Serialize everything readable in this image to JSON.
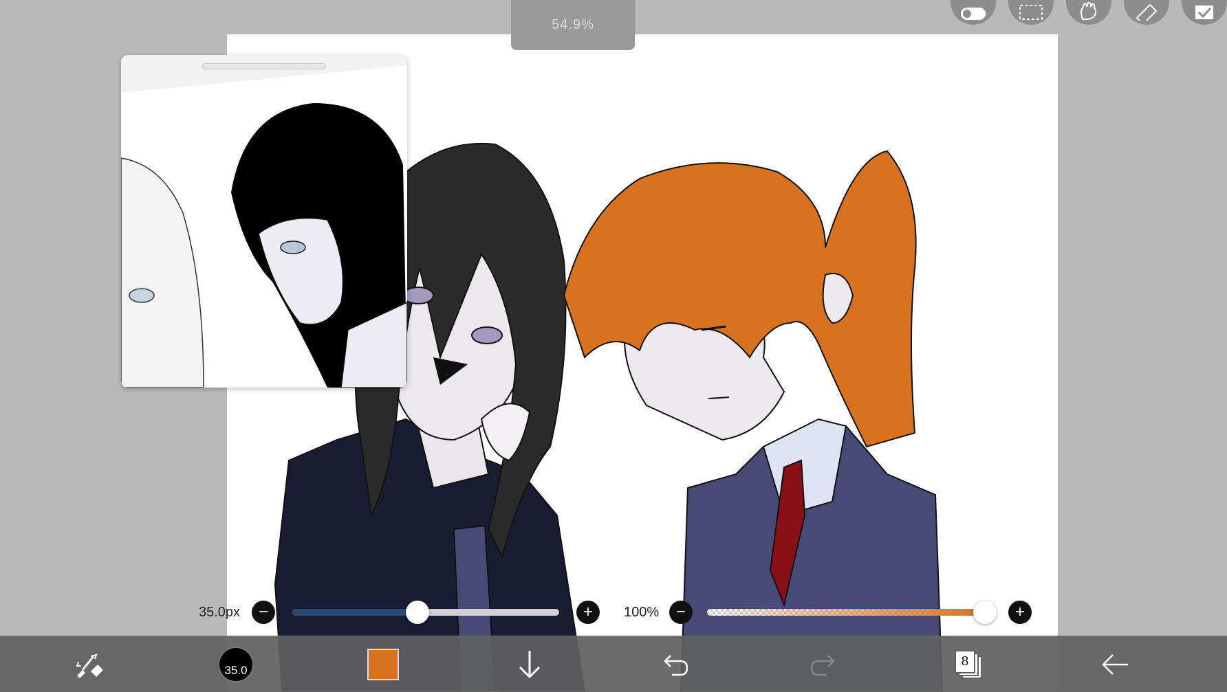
{
  "app": {
    "zoom_label": "54.9%"
  },
  "top_tools": [
    {
      "icon": "toggle-icon"
    },
    {
      "icon": "selection-icon"
    },
    {
      "icon": "hand-icon"
    },
    {
      "icon": "ruler-icon"
    },
    {
      "icon": "check-icon"
    }
  ],
  "brush_size": {
    "label": "35.0px",
    "minus_label": "−",
    "plus_label": "+",
    "value_fraction": 0.47
  },
  "opacity": {
    "label": "100%",
    "minus_label": "−",
    "plus_label": "+",
    "value_fraction": 1.0
  },
  "bottom_bar": {
    "tool_icon": "brush-eraser-swap-icon",
    "brush_badge": "35.0",
    "color": "#d9721e",
    "download_icon": "arrow-down-icon",
    "undo_icon": "undo-icon",
    "redo_icon": "redo-icon",
    "layers_count": "8",
    "back_icon": "arrow-left-icon"
  },
  "colors": {
    "canvas_bg": "#ffffff",
    "workspace_bg": "#b9b9b9",
    "bar_bg": "#5f5f5f",
    "size_fill": "#2a4a74",
    "current_color": "#d9721e",
    "hair_dark": "#2b2b2b",
    "hair_orange": "#d9721e",
    "uniform_dark": "#1a1c33",
    "uniform_blue": "#464a74",
    "tie_red": "#8a1018"
  }
}
